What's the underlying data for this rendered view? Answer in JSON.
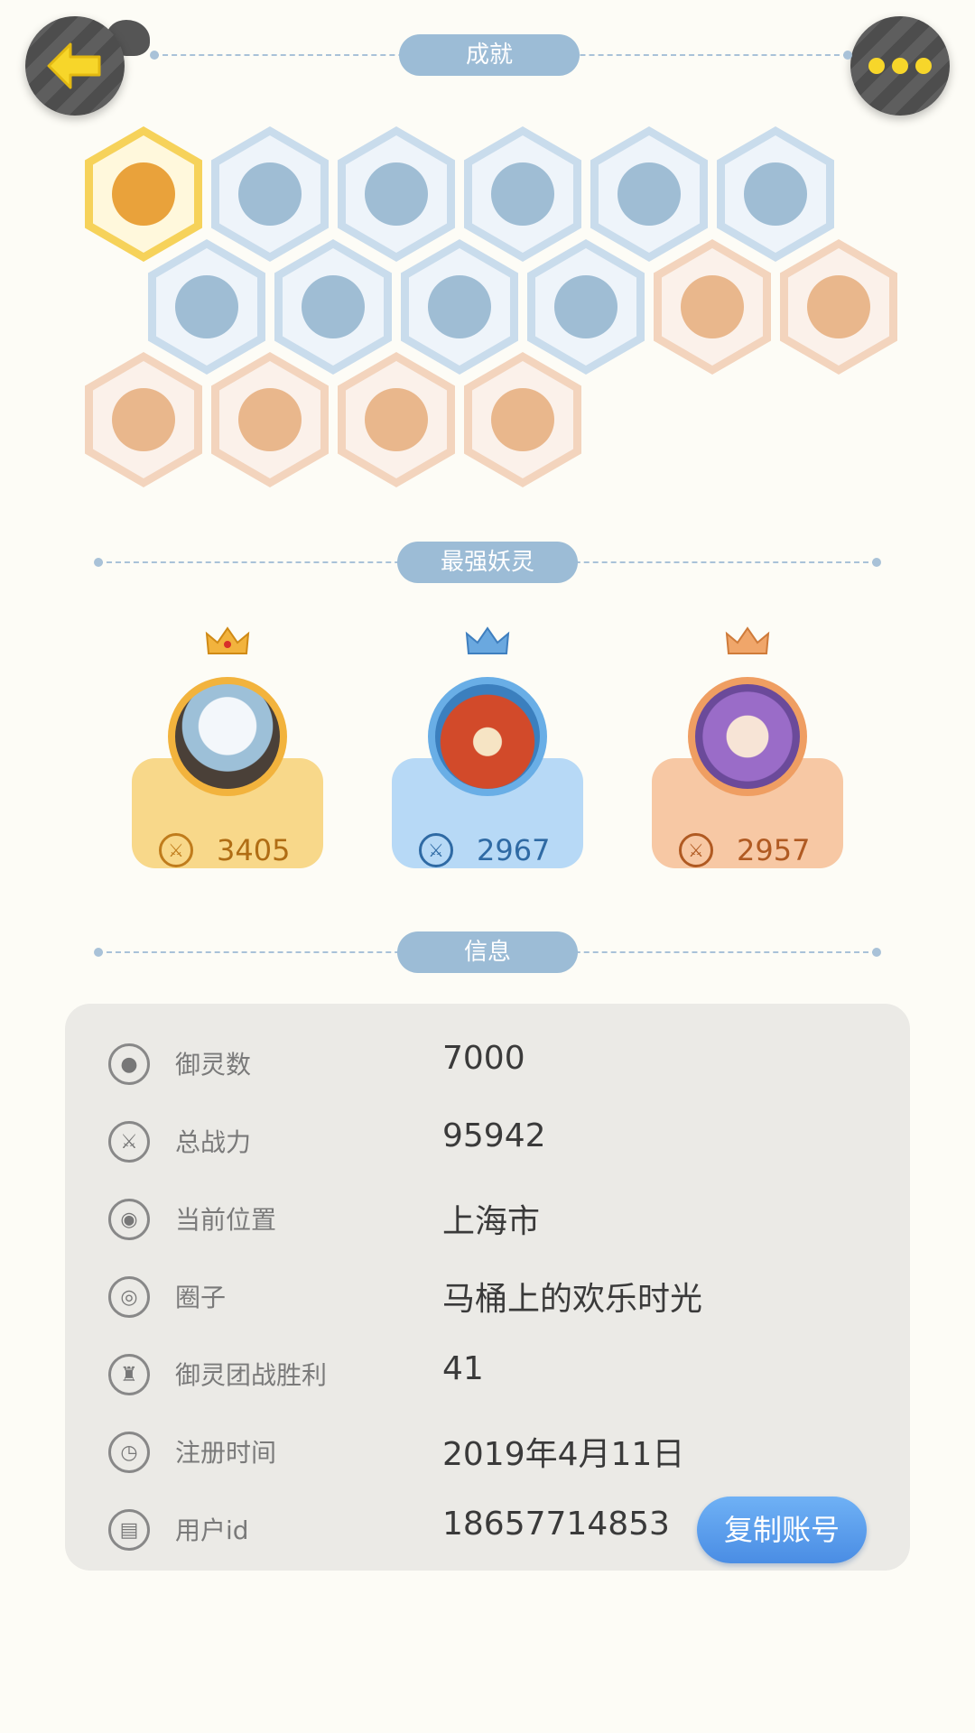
{
  "header": {
    "achievements_title": "成就"
  },
  "badges": [
    {
      "style": "gold",
      "icon": "fox-face-icon"
    },
    {
      "style": "blue",
      "icon": "sneaker-icon"
    },
    {
      "style": "blue",
      "icon": "target-signpost-icon"
    },
    {
      "style": "blue",
      "icon": "moon-icon"
    },
    {
      "style": "blue",
      "icon": "crystal-ball-icon"
    },
    {
      "style": "blue",
      "icon": "crystal-gem-icon"
    },
    {
      "style": "blue",
      "icon": "yin-yang-wave-icon"
    },
    {
      "style": "blue",
      "icon": "cat-spirit-icon"
    },
    {
      "style": "blue",
      "icon": "yin-yang-block-icon"
    },
    {
      "style": "blue",
      "icon": "shield-target-icon"
    },
    {
      "style": "orange",
      "icon": "gingerbread-icon"
    },
    {
      "style": "orange",
      "icon": "cat-cart-icon"
    },
    {
      "style": "orange",
      "icon": "koi-fish-icon"
    },
    {
      "style": "orange",
      "icon": "ox-statue-icon"
    },
    {
      "style": "orange",
      "icon": "two-cats-icon"
    },
    {
      "style": "orange",
      "icon": "fox-book-icon"
    }
  ],
  "strongest": {
    "title": "最强妖灵",
    "spirits": [
      {
        "power": "3405",
        "style": "gold"
      },
      {
        "power": "2967",
        "style": "blue"
      },
      {
        "power": "2957",
        "style": "orange"
      }
    ]
  },
  "info": {
    "title": "信息",
    "rows": [
      {
        "icon": "spirit-icon",
        "label": "御灵数",
        "value": "7000"
      },
      {
        "icon": "sword-icon",
        "label": "总战力",
        "value": "95942"
      },
      {
        "icon": "location-pin-icon",
        "label": "当前位置",
        "value": "上海市"
      },
      {
        "icon": "circle-target-icon",
        "label": "圈子",
        "value": "马桶上的欢乐时光"
      },
      {
        "icon": "trophy-icon",
        "label": "御灵团战胜利",
        "value": "41"
      },
      {
        "icon": "clock-icon",
        "label": "注册时间",
        "value": "2019年4月11日"
      },
      {
        "icon": "id-card-icon",
        "label": "用户id",
        "value": "18657714853"
      }
    ],
    "copy_button": "复制账号"
  },
  "colors": {
    "background": "#fdfcf6",
    "header_pill": "#9cbcd6",
    "panel": "#ebeae6",
    "copy_button": "#4a8de4",
    "back_arrow": "#f7d62a"
  }
}
